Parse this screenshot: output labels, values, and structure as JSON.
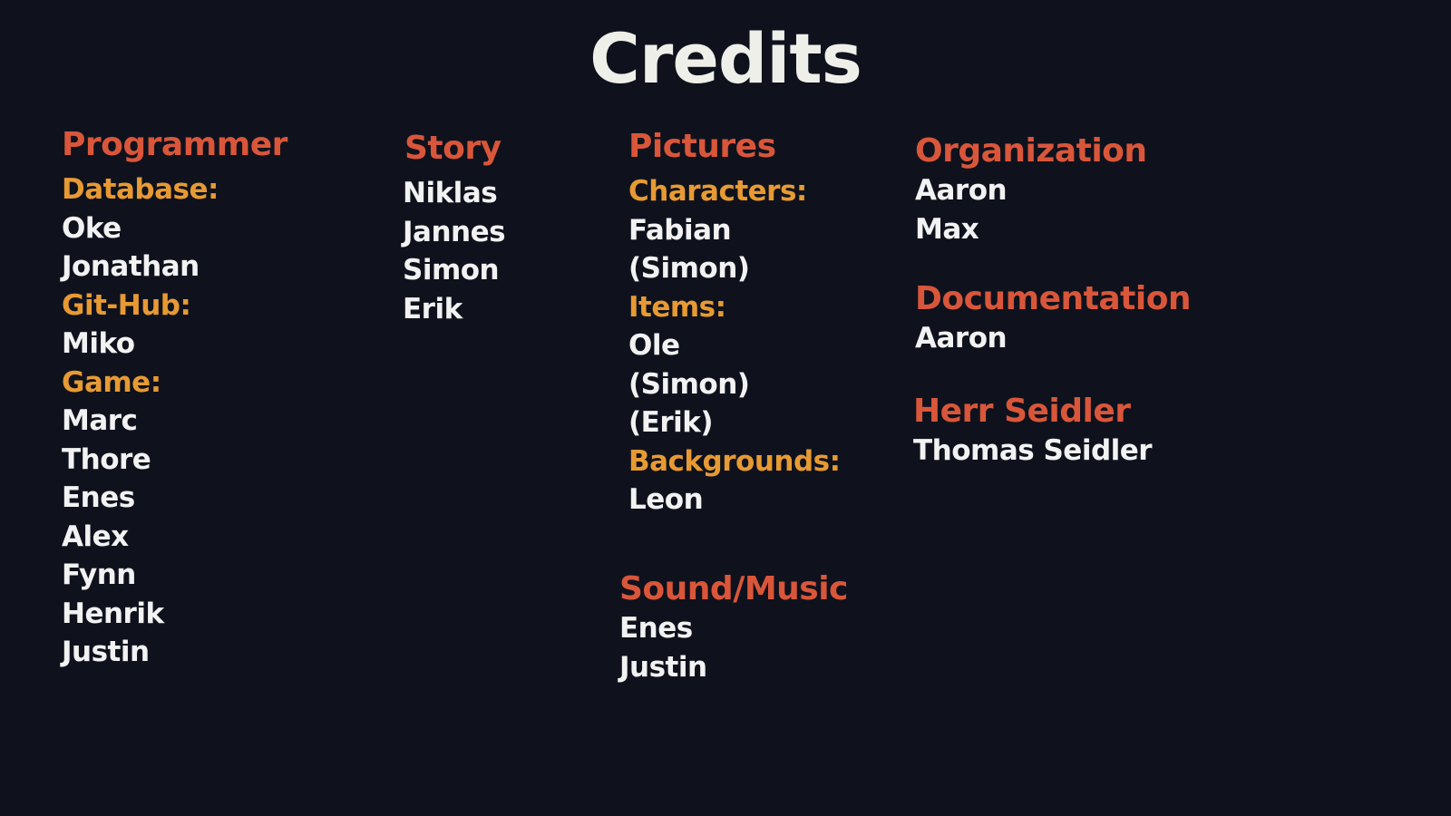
{
  "title": "Credits",
  "programmer": {
    "heading": "Programmer",
    "database_label": "Database:",
    "database_names": [
      "Oke",
      "Jonathan"
    ],
    "github_label": "Git-Hub:",
    "github_names": [
      "Miko"
    ],
    "game_label": "Game:",
    "game_names": [
      "Marc",
      "Thore",
      "Enes",
      "Alex",
      "Fynn",
      "Henrik",
      "Justin"
    ]
  },
  "story": {
    "heading": "Story",
    "names": [
      "Niklas",
      "Jannes",
      "Simon",
      "Erik"
    ]
  },
  "pictures": {
    "heading": "Pictures",
    "characters_label": "Characters:",
    "characters_names": [
      "Fabian",
      "(Simon)"
    ],
    "items_label": "Items:",
    "items_names": [
      "Ole",
      "(Simon)",
      "(Erik)"
    ],
    "backgrounds_label": "Backgrounds:",
    "backgrounds_names": [
      "Leon"
    ]
  },
  "sound_music": {
    "heading": "Sound/Music",
    "names": [
      "Enes",
      "Justin"
    ]
  },
  "organization": {
    "heading": "Organization",
    "names": [
      "Aaron",
      "Max"
    ]
  },
  "documentation": {
    "heading": "Documentation",
    "names": [
      "Aaron"
    ]
  },
  "herr_seidler": {
    "heading": "Herr Seidler",
    "names": [
      "Thomas Seidler"
    ]
  },
  "colors": {
    "background": "#0f121d",
    "heading": "#d9563a",
    "subheading": "#e79a33",
    "name": "#f2f2f2",
    "title": "#efefe9"
  }
}
